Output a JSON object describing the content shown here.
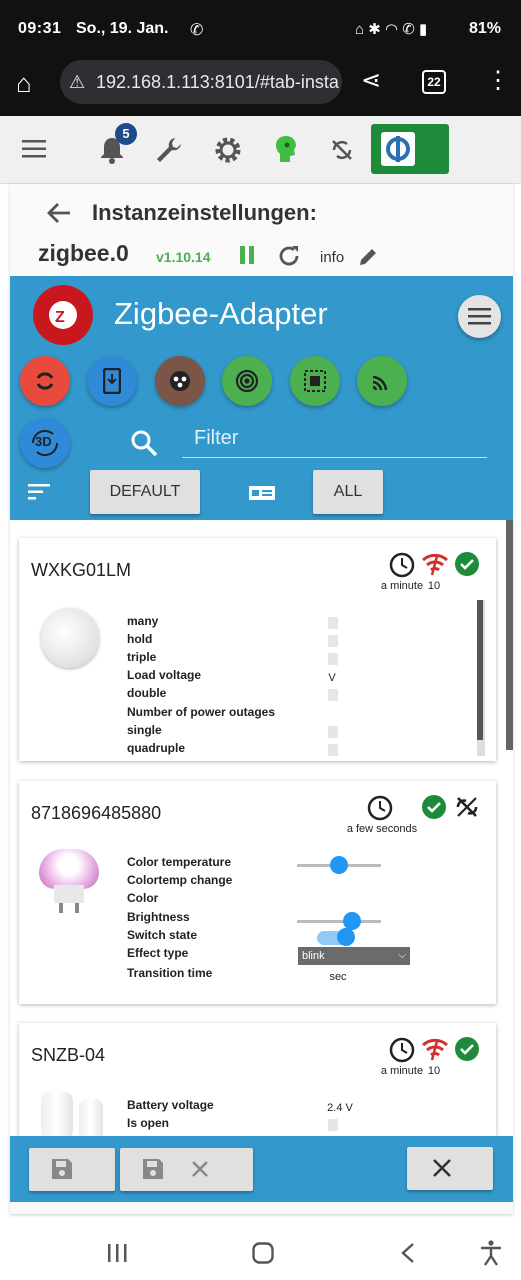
{
  "status_bar": {
    "time": "09:31",
    "date": "So., 19. Jan.",
    "battery": "81%"
  },
  "browser": {
    "url": "192.168.1.113:8101/#tab-insta",
    "tab_count": "22"
  },
  "toolbar": {
    "notification_count": "5"
  },
  "header": {
    "title": "Instanzeinstellungen:",
    "instance": "zigbee.0",
    "version": "v1.10.14",
    "info": "info"
  },
  "adapter": {
    "title": "Zigbee-Adapter",
    "filter_placeholder": "Filter",
    "default_label": "DEFAULT",
    "all_label": "ALL",
    "btn_3d": "3D"
  },
  "devices": [
    {
      "name": "WXKG01LM",
      "last_seen": "a minute",
      "link_quality": "10",
      "states": [
        {
          "label": "many",
          "value": ""
        },
        {
          "label": "hold",
          "value": ""
        },
        {
          "label": "triple",
          "value": ""
        },
        {
          "label": "Load voltage",
          "value": "V"
        },
        {
          "label": "double",
          "value": ""
        },
        {
          "label": "Number of power outages",
          "value": ""
        },
        {
          "label": "single",
          "value": ""
        },
        {
          "label": "quadruple",
          "value": ""
        }
      ]
    },
    {
      "name": "8718696485880",
      "last_seen": "a few seconds",
      "states": [
        {
          "label": "Color temperature"
        },
        {
          "label": "Colortemp change"
        },
        {
          "label": "Color"
        },
        {
          "label": "Brightness"
        },
        {
          "label": "Switch state"
        },
        {
          "label": "Effect type",
          "value": "blink"
        },
        {
          "label": "Transition time",
          "value": "sec"
        }
      ],
      "color_temp_level": 0.5,
      "brightness_level": 0.66,
      "switch_on": true
    },
    {
      "name": "SNZB-04",
      "last_seen": "a minute",
      "link_quality": "10",
      "states": [
        {
          "label": "Battery voltage",
          "value": "2.4 V"
        },
        {
          "label": "Is open",
          "value": ""
        }
      ]
    }
  ],
  "colors": {
    "panel_blue": "#3399cc",
    "ok_green": "#1e8b3a",
    "link_red": "#d32f2f",
    "fab_red": "#e84a3c",
    "fab_blue": "#2f8ad8",
    "fab_brown": "#7a5548",
    "fab_green": "#4caf50"
  }
}
